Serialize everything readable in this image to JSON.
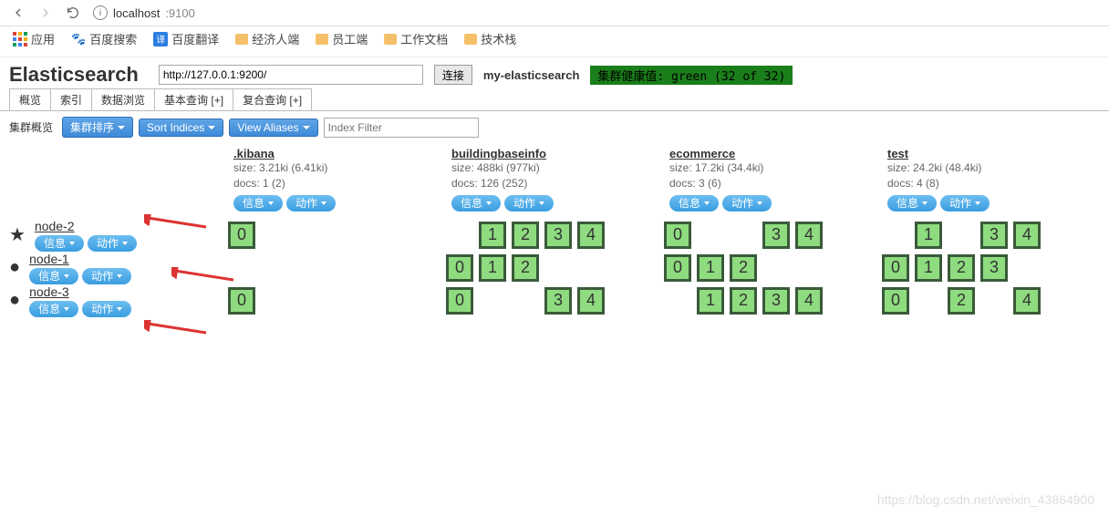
{
  "browser": {
    "url_host": "localhost",
    "url_port": ":9100"
  },
  "bookmarks": {
    "apps_label": "应用",
    "items": [
      "百度搜索",
      "百度翻译",
      "经济人端",
      "员工端",
      "工作文档",
      "技术栈"
    ]
  },
  "header": {
    "logo": "Elasticsearch",
    "conn_url": "http://127.0.0.1:9200/",
    "connect_btn": "连接",
    "cluster_name": "my-elasticsearch",
    "health_text": "集群健康值: green (32 of 32)"
  },
  "tabs": [
    "概览",
    "索引",
    "数据浏览",
    "基本查询 [+]",
    "复合查询 [+]"
  ],
  "toolbar": {
    "label": "集群概览",
    "sort_btn": "集群排序",
    "sort_indices_btn": "Sort Indices",
    "view_aliases_btn": "View Aliases",
    "filter_placeholder": "Index Filter"
  },
  "pill_labels": {
    "info": "信息",
    "action": "动作"
  },
  "indices": [
    {
      "name": ".kibana",
      "size": "size: 3.21ki (6.41ki)",
      "docs": "docs: 1 (2)"
    },
    {
      "name": "buildingbaseinfo",
      "size": "size: 488ki (977ki)",
      "docs": "docs: 126 (252)"
    },
    {
      "name": "ecommerce",
      "size": "size: 17.2ki (34.4ki)",
      "docs": "docs: 3 (6)"
    },
    {
      "name": "test",
      "size": "size: 24.2ki (48.4ki)",
      "docs": "docs: 4 (8)"
    }
  ],
  "nodes": [
    {
      "name": "node-2",
      "master": true,
      "shards": [
        [
          "0"
        ],
        [
          "_",
          "1",
          "2",
          "3",
          "4"
        ],
        [
          "0",
          "_",
          "_",
          "3",
          "4"
        ],
        [
          "_",
          "1",
          "_",
          "3",
          "4"
        ]
      ]
    },
    {
      "name": "node-1",
      "master": false,
      "shards": [
        [],
        [
          "0",
          "1",
          "2"
        ],
        [
          "0",
          "1",
          "2"
        ],
        [
          "0",
          "1",
          "2",
          "3"
        ]
      ]
    },
    {
      "name": "node-3",
      "master": false,
      "shards": [
        [
          "0"
        ],
        [
          "0",
          "_",
          "_",
          "3",
          "4"
        ],
        [
          "_",
          "1",
          "2",
          "3",
          "4"
        ],
        [
          "0",
          "_",
          "2",
          "_",
          "4"
        ]
      ]
    }
  ],
  "watermark": "https://blog.csdn.net/weixin_43864900"
}
